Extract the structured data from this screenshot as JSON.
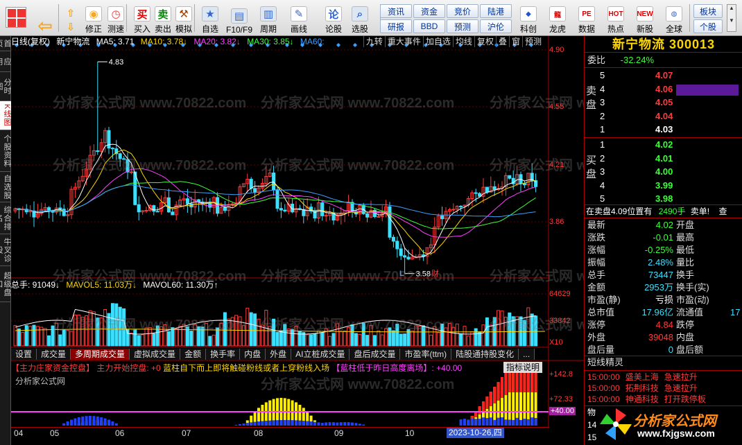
{
  "toolbar": {
    "nav": [
      {
        "label": "修正",
        "icon": "arrows-updown-icon"
      },
      {
        "label": "测速",
        "icon": "clock-icon"
      },
      {
        "label": "买入",
        "icon": "buy-icon"
      },
      {
        "label": "卖出",
        "icon": "sell-icon"
      },
      {
        "label": "模拟",
        "icon": "hammer-icon"
      },
      {
        "label": "自选",
        "icon": "watchlist-icon"
      },
      {
        "label": "F10/F9",
        "icon": "f10-icon"
      },
      {
        "label": "周期",
        "icon": "period-icon"
      },
      {
        "label": "画线",
        "icon": "pencil-icon"
      },
      {
        "label": "论股",
        "icon": "discuss-icon"
      },
      {
        "label": "选股",
        "icon": "stock-pick-icon"
      }
    ],
    "glyphs": {
      "buy": "买",
      "sell": "卖",
      "discuss": "论"
    },
    "small_buttons": [
      [
        "资讯",
        "资金",
        "竞价",
        "陆港"
      ],
      [
        "研报",
        "BBD",
        "预测",
        "沪伦"
      ]
    ],
    "more": [
      {
        "label": "科创",
        "icon": "star-market-icon"
      },
      {
        "label": "龙虎",
        "icon": "dragon-tiger-icon"
      },
      {
        "label": "数据",
        "icon": "pe-data-icon"
      },
      {
        "label": "热点",
        "icon": "hot-icon"
      },
      {
        "label": "新股",
        "icon": "new-stock-icon"
      },
      {
        "label": "全球",
        "icon": "globe-icon"
      }
    ],
    "more_glyphs": {
      "pe": "PE",
      "hot": "HOT",
      "new": "NEW"
    },
    "side_buttons": [
      "板块",
      "个股"
    ]
  },
  "left_tabs": [
    "首页",
    "应用",
    "分时图",
    "K线图",
    "个股资料",
    "自选股",
    "综合排名",
    "牛叉诊股",
    "超级盘口"
  ],
  "chart": {
    "header": {
      "mode": "日线(复权)",
      "name": "新宁物流",
      "ma5": "MA5: 3.71",
      "ma10": "MA10: 3.78↓",
      "ma20": "MA20: 3.82↓",
      "ma30": "MA30: 3.85↓",
      "ma60": "MA60: "
    },
    "tools": [
      "九转",
      "重大事件",
      "加自选",
      "均线",
      "复权",
      "叠",
      "窗",
      "预测"
    ],
    "price_axis": [
      "4.90",
      "4.55",
      "4.21",
      "3.86"
    ],
    "high_label": "4.83",
    "low_label": "3.58",
    "marker_L": "L",
    "marker_cai": "财",
    "volume_header": {
      "total": "总手: 91049↓",
      "mavol5": "MAVOL5: 11.03万↓",
      "mavol60": "MAVOL60: 11.30万↑"
    },
    "volume_axis": [
      "64629",
      "33842",
      "X10"
    ],
    "sub_tabs": [
      "设置",
      "成交量",
      "多周期成交量",
      "虚拟成交量",
      "金额",
      "换手率",
      "内盘",
      "外盘",
      "AI立桩成交量",
      "盘后成交量",
      "市盈率(ttm)",
      "陆股通持股变化",
      "..."
    ],
    "active_sub_tab": "多周期成交量",
    "indicator_banner": {
      "title": "【主力庄家资金控盘】",
      "a": "主力开始控盘: +0",
      "b": "蓝柱自下而上即将触碰粉线或者上穿粉线入场",
      "c": "【蓝柱低于昨日高度离场】: +40.00"
    },
    "indicator_button": "指标说明",
    "indicator_wm": "分析家公式网",
    "indicator_axis": [
      "+142.8",
      "+72.33",
      "+40.00"
    ],
    "x_axis": [
      "04",
      "05",
      "06",
      "07",
      "08",
      "09",
      "10"
    ],
    "current_date": "2023-10-26,四",
    "watermark": "分析家公式网 www.70822.com"
  },
  "quote": {
    "title": "新宁物流 300013",
    "weibi_label": "委比",
    "weibi": "-32.24%",
    "sell_side": "卖盘",
    "buy_side": "买盘",
    "asks": [
      {
        "lvl": "5",
        "price": "4.07"
      },
      {
        "lvl": "4",
        "price": "4.06"
      },
      {
        "lvl": "3",
        "price": "4.05"
      },
      {
        "lvl": "2",
        "price": "4.04"
      },
      {
        "lvl": "1",
        "price": "4.03"
      }
    ],
    "bids": [
      {
        "lvl": "1",
        "price": "4.02"
      },
      {
        "lvl": "2",
        "price": "4.01"
      },
      {
        "lvl": "3",
        "price": "4.00"
      },
      {
        "lvl": "4",
        "price": "3.99"
      },
      {
        "lvl": "5",
        "price": "3.98"
      }
    ],
    "notice_a": "在卖盘4.09位置有",
    "notice_b": "2490手",
    "notice_c": "卖单!",
    "notice_d": "查",
    "stats": [
      {
        "l1": "最新",
        "v1": "4.02",
        "c1": "green",
        "l2": "开盘"
      },
      {
        "l1": "涨跌",
        "v1": "-0.01",
        "c1": "green",
        "l2": "最高"
      },
      {
        "l1": "涨幅",
        "v1": "-0.25%",
        "c1": "green",
        "l2": "最低"
      },
      {
        "l1": "振幅",
        "v1": "2.48%",
        "c1": "cyan",
        "l2": "量比"
      },
      {
        "l1": "总手",
        "v1": "73447",
        "c1": "cyan",
        "l2": "换手"
      },
      {
        "l1": "金额",
        "v1": "2953万",
        "c1": "cyan",
        "l2": "换手(实)"
      },
      {
        "l1": "市盈(静)",
        "v1": "亏损",
        "c1": "white",
        "l2": "市盈(动)"
      },
      {
        "l1": "总市值",
        "v1": "17.96亿",
        "c1": "cyan",
        "l2": "流通值",
        "v2": "17"
      },
      {
        "l1": "涨停",
        "v1": "4.84",
        "c1": "red",
        "l2": "跌停"
      },
      {
        "l1": "外盘",
        "v1": "39048",
        "c1": "red",
        "l2": "内盘"
      },
      {
        "l1": "盘后量",
        "v1": "0",
        "c1": "cyan",
        "l2": "盘后额"
      }
    ],
    "news_title": "短线精灵",
    "news": [
      {
        "time": "15:00:00",
        "name": "盛美上海",
        "event": "急速拉升"
      },
      {
        "time": "15:00:00",
        "name": "拓荆科技",
        "event": "急速拉升"
      },
      {
        "time": "15:00:00",
        "name": "神通科技",
        "event": "打开跌停板"
      }
    ],
    "logo_text": "分析家公式网",
    "logo_url": "www.fxjgsw.com",
    "bottom_digits": [
      "物",
      "14",
      "15"
    ]
  },
  "colors": {
    "up": "#ff3b3b",
    "down": "#3ce0ff",
    "ma5": "#ffffff",
    "ma10": "#ffd700",
    "ma20": "#ff40ff",
    "ma30": "#3cff3c",
    "ma60": "#3ca0ff"
  }
}
